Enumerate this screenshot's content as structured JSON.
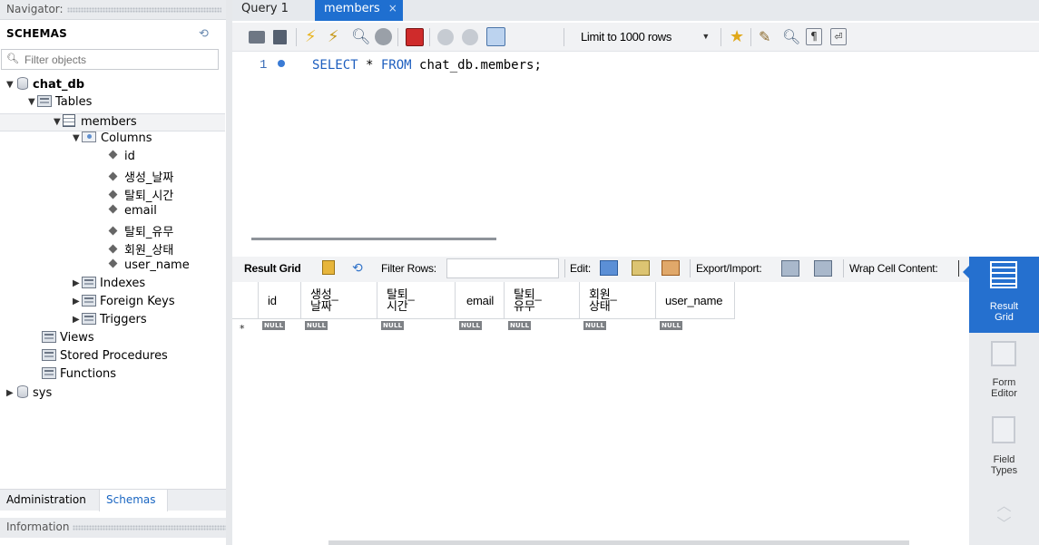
{
  "navigator": {
    "title": "Navigator:",
    "schemas_label": "SCHEMAS",
    "filter_placeholder": "Filter objects",
    "tree": {
      "db1": "chat_db",
      "tables": "Tables",
      "table": "members",
      "columns_folder": "Columns",
      "columns": [
        "id",
        "생성_날짜",
        "탈퇴_시간",
        "email",
        "탈퇴_유무",
        "회원_상태",
        "user_name"
      ],
      "indexes": "Indexes",
      "foreign_keys": "Foreign Keys",
      "triggers": "Triggers",
      "views": "Views",
      "stored_procedures": "Stored Procedures",
      "functions": "Functions",
      "db2": "sys"
    },
    "bottom_tabs": [
      "Administration",
      "Schemas"
    ],
    "info_title": "Information"
  },
  "tabs": [
    {
      "label": "Query 1"
    },
    {
      "label": "members",
      "close": "×"
    }
  ],
  "toolbar": {
    "limit_label": "Limit to 1000 rows"
  },
  "editor": {
    "line_number": "1",
    "sql_kw1": "SELECT",
    "sql_star": " * ",
    "sql_kw2": "FROM",
    "sql_rest": " chat_db.members;"
  },
  "result_bar": {
    "result_grid": "Result Grid",
    "filter_rows": "Filter Rows:",
    "edit": "Edit:",
    "export_import": "Export/Import:",
    "wrap": "Wrap Cell Content:"
  },
  "grid": {
    "headers": [
      "id",
      "생성_\n날짜",
      "탈퇴_\n시간",
      "email",
      "탈퇴_\n유무",
      "회원_\n상태",
      "user_name"
    ],
    "null_label": "NULL",
    "new_row_marker": "*"
  },
  "right_panel": {
    "result_grid": "Result\nGrid",
    "form_editor": "Form\nEditor",
    "field_types": "Field\nTypes"
  },
  "colors": {
    "accent": "#1f6fd0",
    "sidebar_active": "#2570cf",
    "schemas_tab_text": "#1a66c2"
  }
}
